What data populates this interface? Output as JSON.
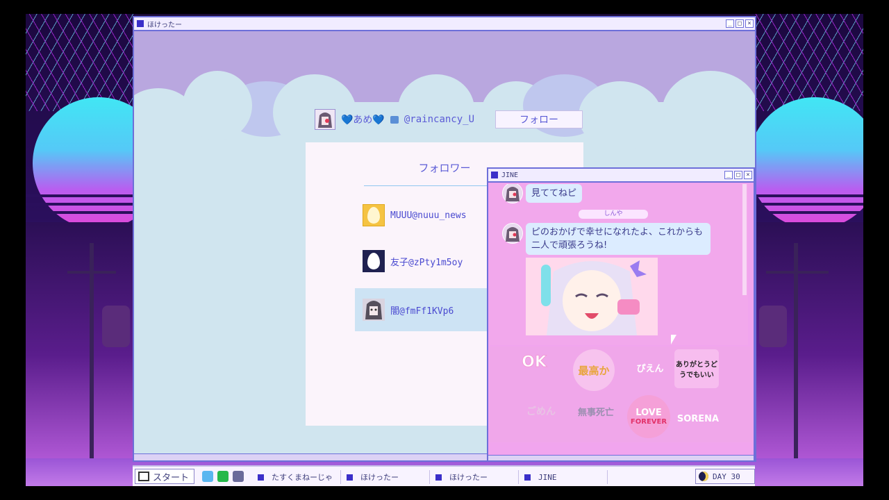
{
  "main_window": {
    "title": "ほけったー"
  },
  "profile": {
    "name": "💙あめ💙",
    "handle": "@raincancy_U",
    "follow_button": "フォロー"
  },
  "followers": {
    "title": "フォロワー",
    "items": [
      {
        "label": "MUUU@nuuu_news",
        "avatar": "yellow-egg-avatar"
      },
      {
        "label": "友子@zPty1m5oy",
        "avatar": "navy-egg-avatar"
      },
      {
        "label": "闇@fmFf1KVp6",
        "avatar": "girl-avatar"
      }
    ]
  },
  "jine": {
    "title": "JINE",
    "messages": [
      {
        "text": "見ててねピ"
      },
      {
        "text": "ピのおかげで幸せになれたよ、これからも二人で頑張ろうね!"
      }
    ],
    "tag": "しんや",
    "stamps": [
      "OK",
      "最高か",
      "ぴえん",
      "ありがとうどうでもいい",
      "ごめん",
      "無事死亡",
      "LOVE",
      "FOREVER",
      "SORENA"
    ]
  },
  "taskbar": {
    "start": "スタート",
    "tasks": [
      "たすくまねーじゃ",
      "ほけったー",
      "ほけったー",
      "JINE"
    ],
    "day": "DAY 30"
  },
  "colors": {
    "accent": "#5b5bd6",
    "window_border": "#6d6fd9",
    "jine_bg": "#f2a8ec"
  }
}
